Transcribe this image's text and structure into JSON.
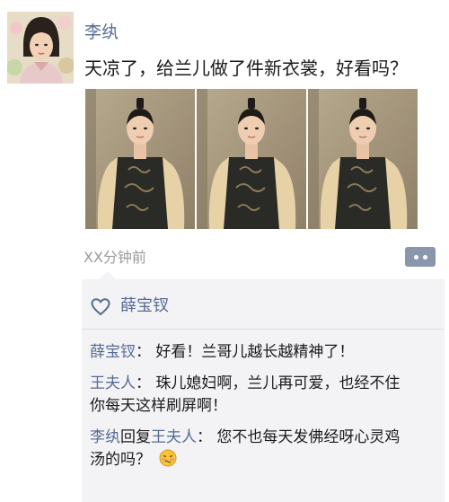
{
  "post": {
    "author": "李纨",
    "text": "天凉了，给兰儿做了件新衣裳，好看吗？",
    "time": "XX分钟前",
    "photos": [
      "photo",
      "photo",
      "photo"
    ]
  },
  "likes": {
    "icon": "heart-outline-icon",
    "names": "薛宝钗"
  },
  "comments": [
    {
      "author": "薛宝钗",
      "separator": "：",
      "text": "好看！兰哥儿越长越精神了！"
    },
    {
      "author": "王夫人",
      "separator": "：",
      "text_line1": "珠儿媳妇啊，兰儿再可爱，也经不住",
      "text_line2": "你每天这样刷屏啊！"
    },
    {
      "author": "李纨",
      "reply_word": "回复",
      "reply_to": "王夫人",
      "separator": "：",
      "text_line1": "您不也每天发佛经呀心灵鸡",
      "text_line2": "汤的吗？",
      "emoji": "awkward-face-icon"
    }
  ],
  "colors": {
    "name_blue": "#576b95",
    "comment_bg": "#f3f3f5",
    "more_button": "#8a96ac",
    "time_gray": "#9b9b9b"
  }
}
